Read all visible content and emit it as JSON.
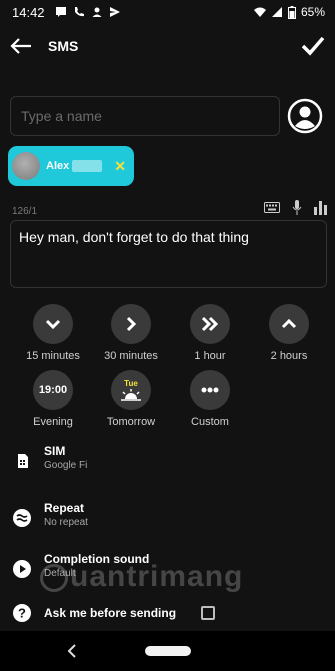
{
  "status_bar": {
    "time": "14:42",
    "battery": "65%"
  },
  "app_bar": {
    "title": "SMS"
  },
  "recipient": {
    "placeholder": "Type a name"
  },
  "chip": {
    "name": "Alex"
  },
  "message": {
    "char_count": "126/1",
    "text": "Hey man, don't forget to do that thing"
  },
  "time_options": [
    {
      "label": "15 minutes",
      "icon": "chevron-down-icon"
    },
    {
      "label": "30 minutes",
      "icon": "chevron-right-icon"
    },
    {
      "label": "1 hour",
      "icon": "double-chevron-right-icon"
    },
    {
      "label": "2 hours",
      "icon": "chevron-up-icon"
    }
  ],
  "day_options": [
    {
      "label": "Evening",
      "badge": "19:00"
    },
    {
      "label": "Tomorrow",
      "badge": "Tue"
    },
    {
      "label": "Custom",
      "icon": "more-dots-icon"
    }
  ],
  "settings": {
    "sim": {
      "title": "SIM",
      "value": "Google Fi"
    },
    "repeat": {
      "title": "Repeat",
      "value": "No repeat"
    },
    "sound": {
      "title": "Completion sound",
      "value": "Default"
    },
    "ask": {
      "title": "Ask me before sending"
    }
  },
  "watermark": "uantrimang",
  "colors": {
    "background": "#121212",
    "chip": "#1fc9d9",
    "chip_remove": "#f3e23a",
    "round_button": "#3a3a3a"
  }
}
